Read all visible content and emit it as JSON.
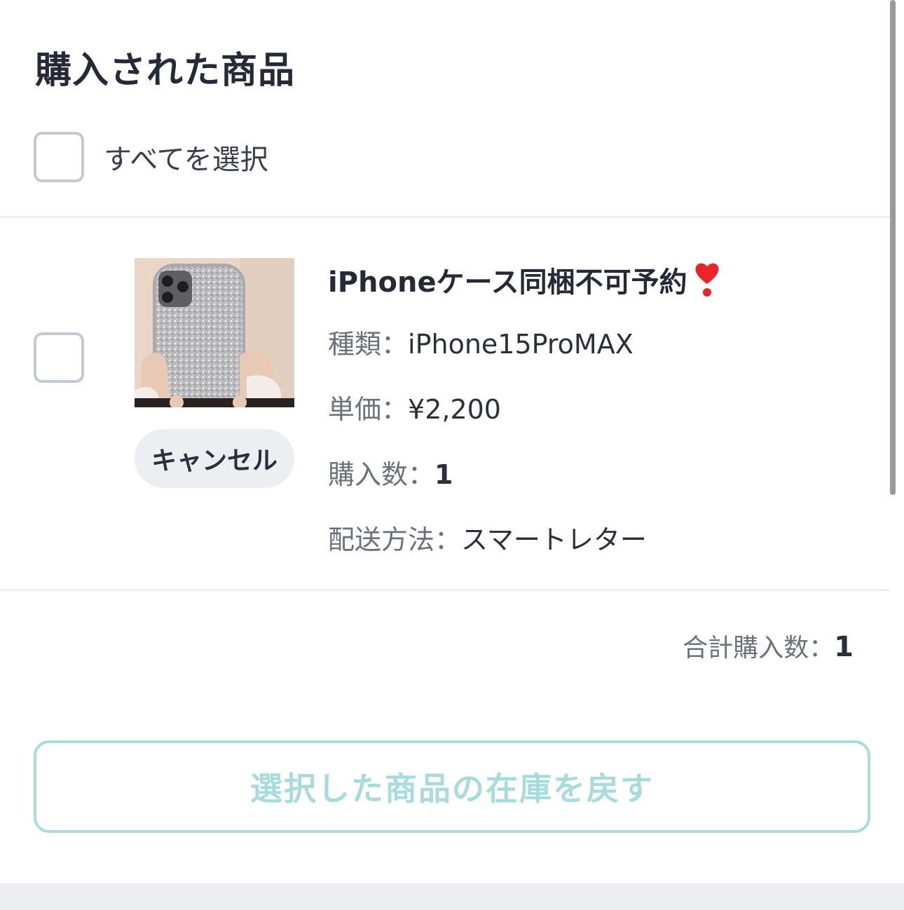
{
  "header": {
    "title": "購入された商品"
  },
  "select_all": {
    "label": "すべてを選択",
    "checked": false
  },
  "item": {
    "checked": false,
    "name": "iPhoneケース同梱不可予約",
    "emoji_icon": "heavy-heart-exclamation",
    "type_label": "種類：",
    "type_value": "iPhone15ProMAX",
    "price_label": "単価：",
    "price_value": "¥2,200",
    "qty_label": "購入数：",
    "qty_value": "1",
    "shipping_label": "配送方法：",
    "shipping_value": "スマートレター",
    "cancel_label": "キャンセル",
    "image_alt": "glitter-phone-case-photo"
  },
  "summary": {
    "total_label": "合計購入数：",
    "total_value": "1"
  },
  "actions": {
    "restore_label": "選択した商品の在庫を戻す",
    "restore_enabled": false
  },
  "colors": {
    "accent_disabled": "#a8dcdc",
    "cancel_bg": "#eceef2",
    "checkbox_border": "#c4cad2"
  }
}
